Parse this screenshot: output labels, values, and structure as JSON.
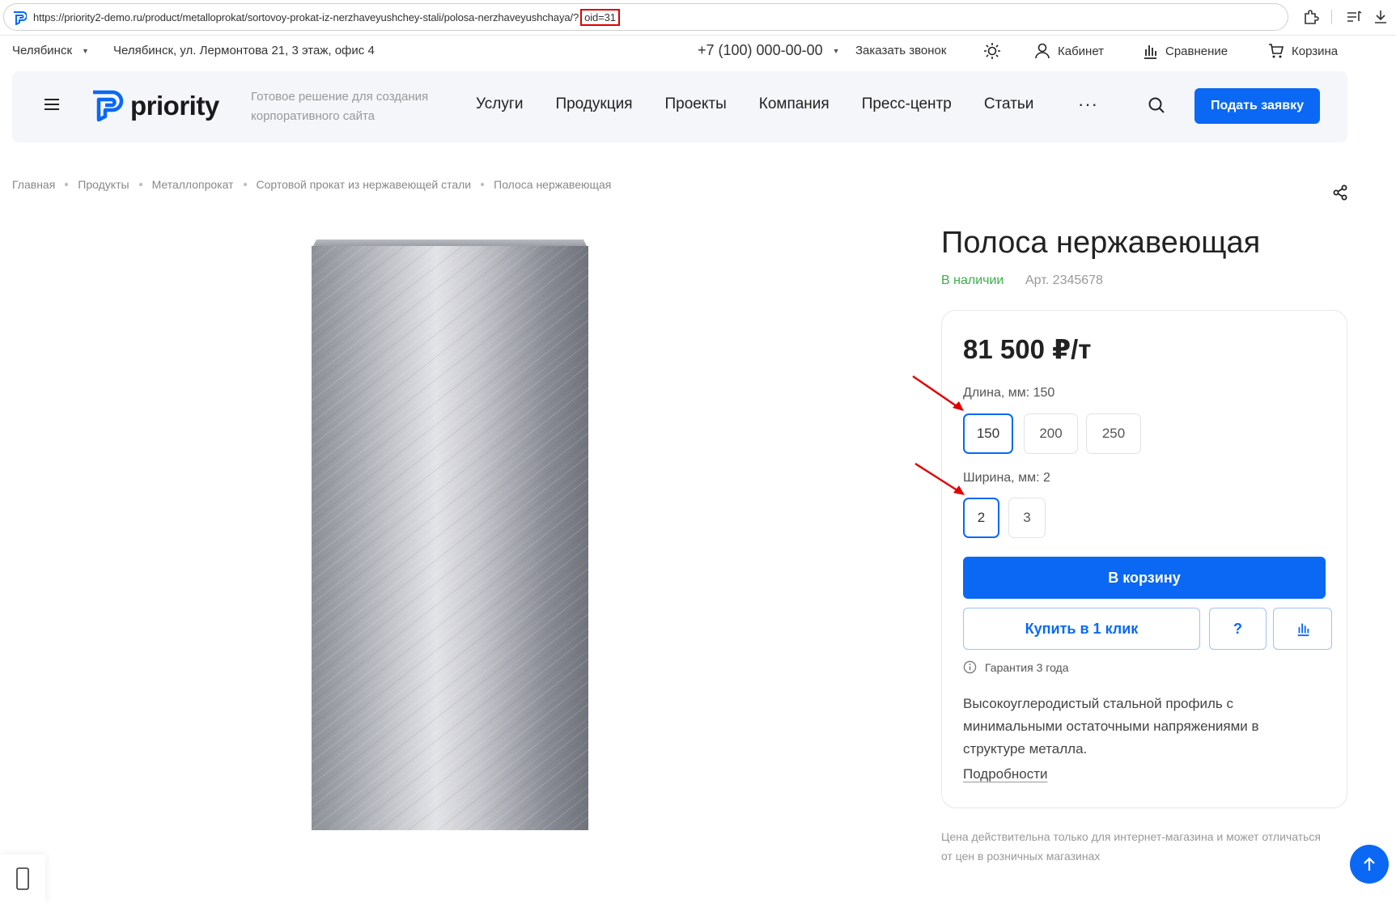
{
  "browser": {
    "url_main": "https://priority2-demo.ru/product/metalloprokat/sortovoy-prokat-iz-nerzhaveyushchey-stali/polosa-nerzhaveyushchaya/?",
    "url_param": "oid=31"
  },
  "topline": {
    "city": "Челябинск",
    "address": "Челябинск, ул. Лермонтова 21, 3 этаж, офис 4",
    "phone": "+7 (100) 000-00-00",
    "callback": "Заказать звонок",
    "cabinet": "Кабинет",
    "compare": "Сравнение",
    "cart": "Корзина"
  },
  "header": {
    "logo_text": "priority",
    "slogan": "Готовое решение для создания корпоративного сайта",
    "nav": [
      "Услуги",
      "Продукция",
      "Проекты",
      "Компания",
      "Пресс-центр",
      "Статьи"
    ],
    "more": "···",
    "cta": "Подать заявку"
  },
  "breadcrumb": [
    "Главная",
    "Продукты",
    "Металлопрокат",
    "Сортовой прокат из нержавеющей стали",
    "Полоса нержавеющая"
  ],
  "product": {
    "title": "Полоса нержавеющая",
    "stock": "В наличии",
    "sku": "Арт. 2345678",
    "price": "81 500 ₽/т",
    "length_label": "Длина, мм: 150",
    "length_options": [
      "150",
      "200",
      "250"
    ],
    "width_label": "Ширина, мм: 2",
    "width_options": [
      "2",
      "3"
    ],
    "add_to_cart": "В корзину",
    "one_click": "Купить в 1 клик",
    "question": "?",
    "warranty": "Гарантия 3 года",
    "description": "Высокоуглеродистый стальной профиль с минимальными остаточными напряжениями в структуре металла.",
    "more_link": "Подробности",
    "price_note": "Цена действительна только для интернет-магазина и может отличаться от цен в розничных магазинах"
  },
  "colors": {
    "accent": "#0a68f5",
    "in_stock": "#3cb04a",
    "annotation": "#e00000"
  }
}
